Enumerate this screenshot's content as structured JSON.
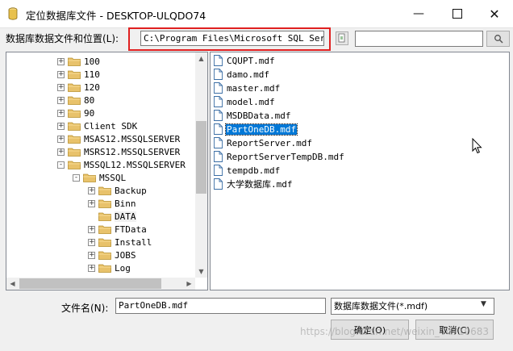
{
  "window": {
    "title": "定位数据库文件 - DESKTOP-ULQDO74",
    "controls": [
      "minimize",
      "maximize",
      "close"
    ]
  },
  "location": {
    "label": "数据库数据文件和位置(L):",
    "path": "C:\\Program Files\\Microsoft SQL Server"
  },
  "tree": {
    "items": [
      {
        "label": "100",
        "expander": "+",
        "level": 0
      },
      {
        "label": "110",
        "expander": "+",
        "level": 0
      },
      {
        "label": "120",
        "expander": "+",
        "level": 0
      },
      {
        "label": "80",
        "expander": "+",
        "level": 0
      },
      {
        "label": "90",
        "expander": "+",
        "level": 0
      },
      {
        "label": "Client SDK",
        "expander": "+",
        "level": 0
      },
      {
        "label": "MSAS12.MSSQLSERVER",
        "expander": "+",
        "level": 0
      },
      {
        "label": "MSRS12.MSSQLSERVER",
        "expander": "+",
        "level": 0
      },
      {
        "label": "MSSQL12.MSSQLSERVER",
        "expander": "-",
        "level": 0
      },
      {
        "label": "MSSQL",
        "expander": "-",
        "level": 1
      },
      {
        "label": "Backup",
        "expander": "+",
        "level": 2
      },
      {
        "label": "Binn",
        "expander": "+",
        "level": 2
      },
      {
        "label": "DATA",
        "expander": "",
        "level": 2
      },
      {
        "label": "FTData",
        "expander": "+",
        "level": 2
      },
      {
        "label": "Install",
        "expander": "+",
        "level": 2
      },
      {
        "label": "JOBS",
        "expander": "+",
        "level": 2
      },
      {
        "label": "Log",
        "expander": "+",
        "level": 2
      }
    ],
    "selected": "DATA"
  },
  "files": {
    "items": [
      "CQUPT.mdf",
      "damo.mdf",
      "master.mdf",
      "model.mdf",
      "MSDBData.mdf",
      "PartOneDB.mdf",
      "ReportServer.mdf",
      "ReportServerTempDB.mdf",
      "tempdb.mdf",
      "大学数据库.mdf"
    ],
    "selected": "PartOneDB.mdf"
  },
  "filename": {
    "label": "文件名(N):",
    "value": "PartOneDB.mdf"
  },
  "filetype": {
    "value": "数据库数据文件(*.mdf)"
  },
  "buttons": {
    "ok": "确定(O)",
    "cancel": "取消(C)"
  },
  "watermark": "https://blog.csdn.net/weixin_44710683",
  "colors": {
    "selection": "#0078d7",
    "highlight_border": "#e02020",
    "folder": "#e8c26b"
  }
}
